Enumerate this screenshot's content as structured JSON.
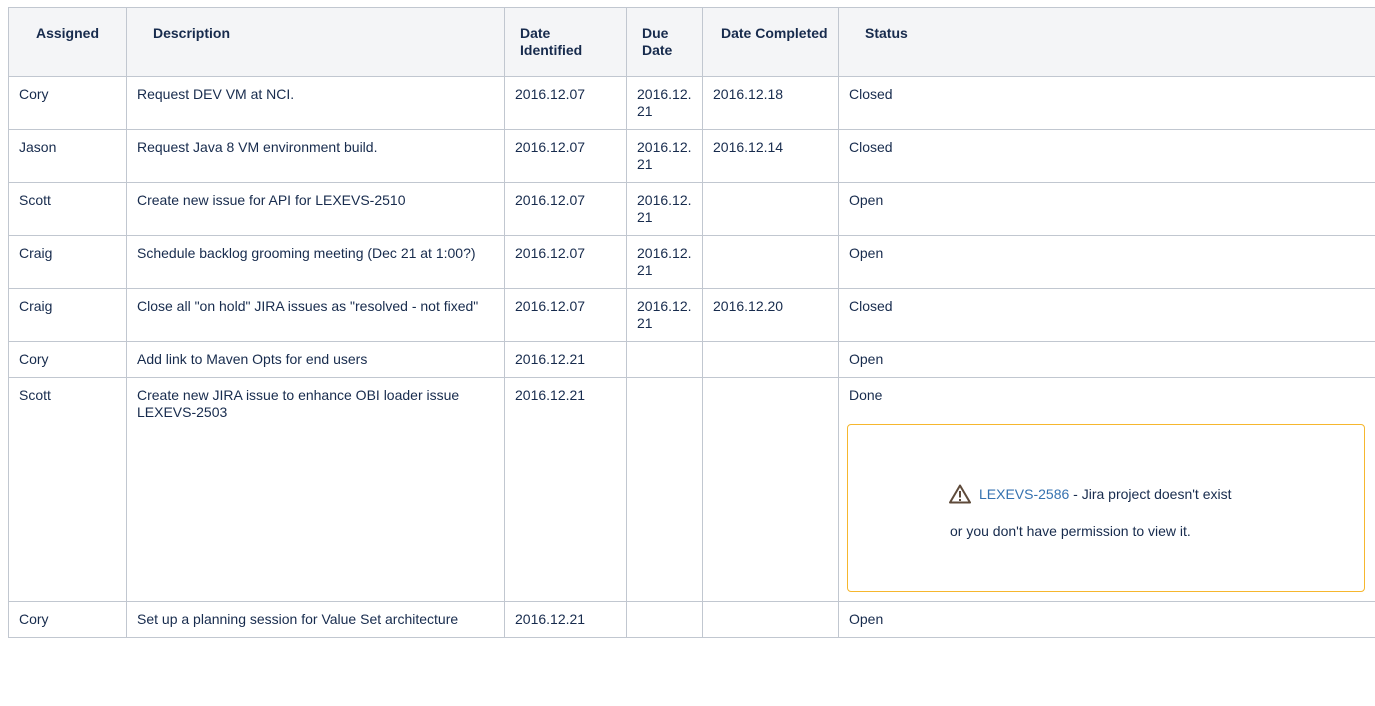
{
  "table": {
    "headers": {
      "assigned": "Assigned",
      "description": "Description",
      "date_identified": "Date Identified",
      "due_date": "Due Date",
      "date_completed": "Date Completed",
      "status": "Status"
    },
    "rows": [
      {
        "assigned": "Cory",
        "description": "Request DEV VM at NCI.",
        "date_identified": "2016.12.07",
        "due_date": "2016.12.21",
        "date_completed": "2016.12.18",
        "status": "Closed"
      },
      {
        "assigned": "Jason",
        "description": "Request Java 8 VM environment build.",
        "date_identified": "2016.12.07",
        "due_date": "2016.12.21",
        "date_completed": "2016.12.14",
        "status": "Closed"
      },
      {
        "assigned": "Scott",
        "description": "Create new issue for API for LEXEVS-2510",
        "date_identified": "2016.12.07",
        "due_date": "2016.12.21",
        "date_completed": "",
        "status": "Open"
      },
      {
        "assigned": "Craig",
        "description": "Schedule backlog grooming meeting (Dec 21 at 1:00?)",
        "date_identified": "2016.12.07",
        "due_date": "2016.12.21",
        "date_completed": "",
        "status": "Open"
      },
      {
        "assigned": "Craig",
        "description": "Close all \"on hold\" JIRA issues as \"resolved - not fixed\"",
        "date_identified": "2016.12.07",
        "due_date": "2016.12.21",
        "date_completed": "2016.12.20",
        "status": "Closed"
      },
      {
        "assigned": "Cory",
        "description": "Add link to Maven Opts for end users",
        "date_identified": "2016.12.21",
        "due_date": "",
        "date_completed": "",
        "status": "Open"
      },
      {
        "assigned": "Scott",
        "description": "Create new JIRA issue to enhance OBI loader issue LEXEVS-2503",
        "date_identified": "2016.12.21",
        "due_date": "",
        "date_completed": "",
        "status": "Done",
        "jira": {
          "link": "LEXEVS-2586",
          "message_line1": " - Jira project doesn't exist",
          "message_line2": "or you don't have permission to view it.",
          "icon": "warning-icon"
        }
      },
      {
        "assigned": "Cory",
        "description": "Set up a planning session for Value Set architecture",
        "date_identified": "2016.12.21",
        "due_date": "",
        "date_completed": "",
        "status": "Open"
      }
    ]
  },
  "colors": {
    "border": "#c1c7d0",
    "header_bg": "#f4f5f7",
    "link": "#3572b0",
    "warning_border": "#f6b72e"
  }
}
